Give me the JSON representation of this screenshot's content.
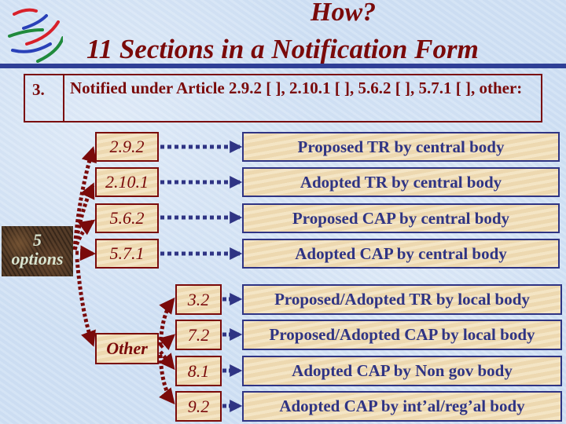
{
  "title": {
    "line1": "How?",
    "line2": "11 Sections in a Notification Form"
  },
  "question": {
    "number": "3.",
    "text": "Notified under Article 2.9.2 [   ], 2.10.1 [   ], 5.6.2 [   ], 5.7.1 [   ], other:"
  },
  "options_box": {
    "line1": "5",
    "line2": "options"
  },
  "central": [
    {
      "code": "2.9.2",
      "description": "Proposed TR by central body"
    },
    {
      "code": "2.10.1",
      "description": "Adopted TR by central body"
    },
    {
      "code": "5.6.2",
      "description": "Proposed CAP by central body"
    },
    {
      "code": "5.7.1",
      "description": "Adopted CAP by central body"
    }
  ],
  "other": {
    "label": "Other",
    "items": [
      {
        "code": "3.2",
        "description": "Proposed/Adopted TR by local body"
      },
      {
        "code": "7.2",
        "description": "Proposed/Adopted CAP by local body"
      },
      {
        "code": "8.1",
        "description": "Adopted CAP by Non gov body"
      },
      {
        "code": "9.2",
        "description": "Adopted CAP by int’al/reg’al body"
      }
    ]
  },
  "colors": {
    "maroon": "#7a0a0a",
    "navy": "#2f3484",
    "tan": "#f2dfb8",
    "background": "#cfe0f4"
  }
}
